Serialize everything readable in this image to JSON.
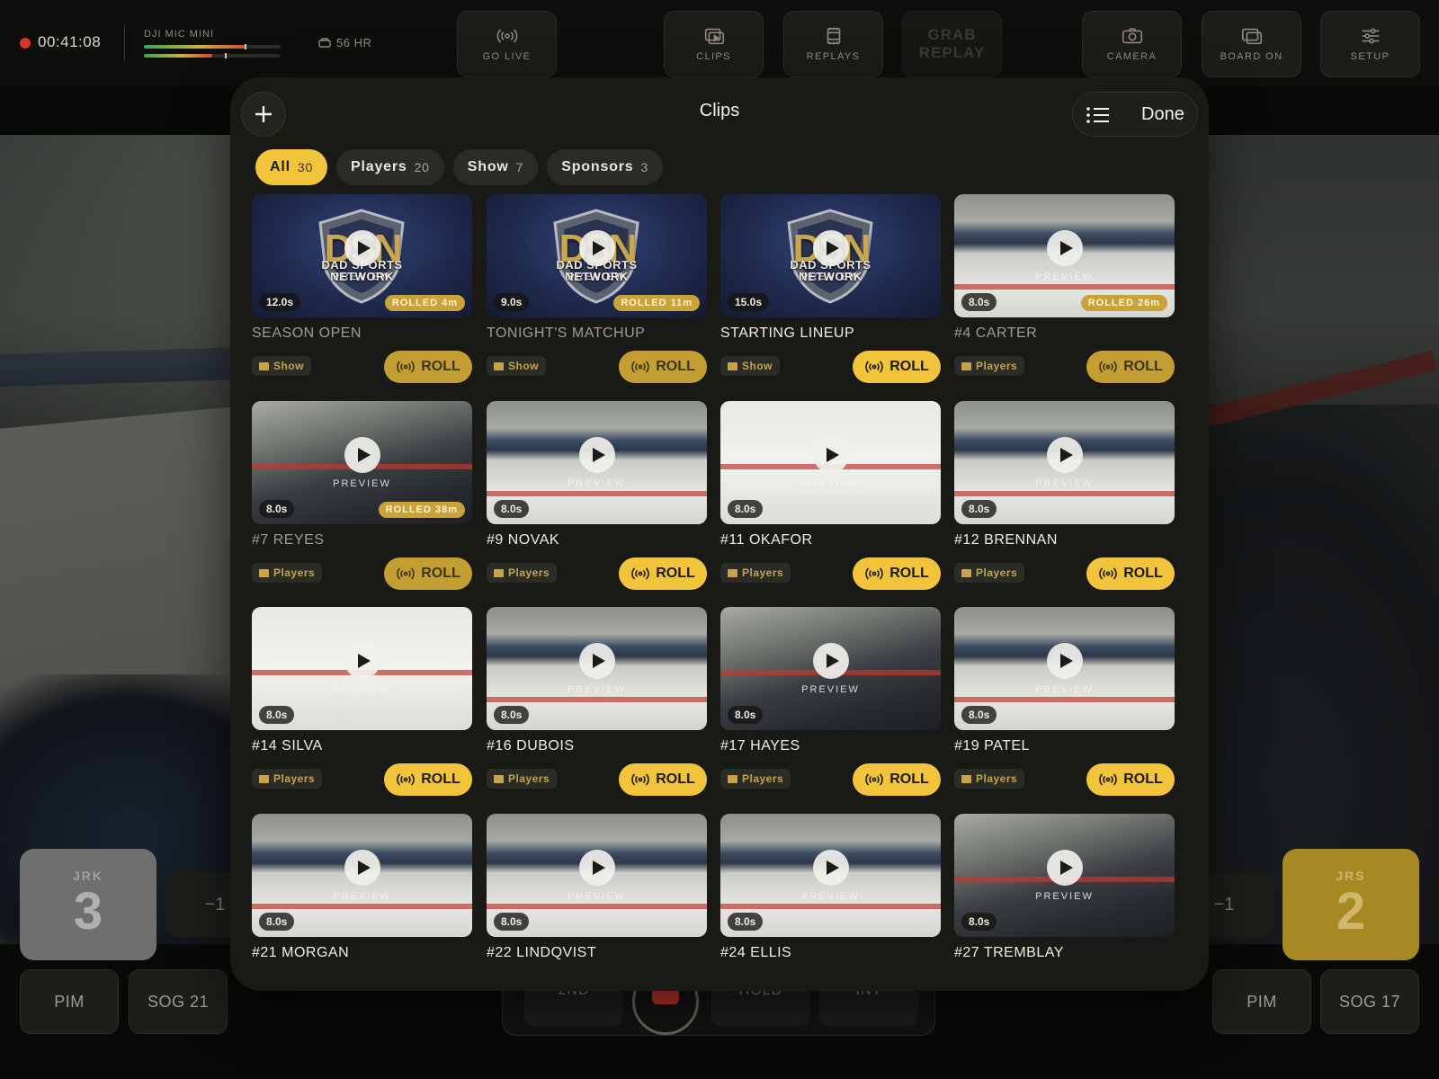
{
  "recorder": {
    "time": "00:41:08",
    "mic_label": "DJI MIC MINI",
    "mic_level_1": 0.75,
    "mic_level_2": 0.5,
    "storage": "56 HR"
  },
  "toolbar": {
    "go_live": "GO LIVE",
    "clips": "CLIPS",
    "replays": "REPLAYS",
    "grab_replay_line1": "GRAB",
    "grab_replay_line2": "REPLAY",
    "camera": "CAMERA",
    "board_on": "BOARD ON",
    "setup": "SETUP"
  },
  "scoreboard": {
    "home": {
      "team": "JRK",
      "score": "3",
      "minus": "−1",
      "pim": "PIM",
      "sog": "SOG 21"
    },
    "away": {
      "team": "JRS",
      "score": "2",
      "minus": "−1",
      "pim": "PIM",
      "sog": "SOG 17"
    },
    "controls": {
      "left": "2ND",
      "right1": "HOLD",
      "right2": "INT"
    }
  },
  "sheet": {
    "title": "Clips",
    "done": "Done",
    "filters": [
      {
        "label": "All",
        "count": "30",
        "active": true
      },
      {
        "label": "Players",
        "count": "20",
        "active": false
      },
      {
        "label": "Show",
        "count": "7",
        "active": false
      },
      {
        "label": "Sponsors",
        "count": "3",
        "active": false
      }
    ],
    "roll_label": "ROLL",
    "preview_label": "PREVIEW",
    "logo_text": "DSN",
    "logo_sub_line1": "DAD SPORTS",
    "logo_sub_line2": "NETWORK",
    "clips": [
      {
        "name": "SEASON OPEN",
        "duration": "12.0s",
        "rolled": "ROLLED 4m",
        "category": "Show",
        "thumb": "logo",
        "dim": true
      },
      {
        "name": "TONIGHT'S MATCHUP",
        "duration": "9.0s",
        "rolled": "ROLLED 11m",
        "category": "Show",
        "thumb": "logo",
        "dim": true
      },
      {
        "name": "STARTING LINEUP",
        "duration": "15.0s",
        "rolled": "",
        "category": "Show",
        "thumb": "logo",
        "dim": false
      },
      {
        "name": "#4 CARTER",
        "duration": "8.0s",
        "rolled": "ROLLED 26m",
        "category": "Players",
        "thumb": "rink",
        "dim": true
      },
      {
        "name": "#7 REYES",
        "duration": "8.0s",
        "rolled": "ROLLED 38m",
        "category": "Players",
        "thumb": "crowd",
        "dim": true
      },
      {
        "name": "#9 NOVAK",
        "duration": "8.0s",
        "rolled": "",
        "category": "Players",
        "thumb": "rink",
        "dim": false
      },
      {
        "name": "#11 OKAFOR",
        "duration": "8.0s",
        "rolled": "",
        "category": "Players",
        "thumb": "ice",
        "dim": false
      },
      {
        "name": "#12 BRENNAN",
        "duration": "8.0s",
        "rolled": "",
        "category": "Players",
        "thumb": "rink",
        "dim": false
      },
      {
        "name": "#14 SILVA",
        "duration": "8.0s",
        "rolled": "",
        "category": "Players",
        "thumb": "ice",
        "dim": false
      },
      {
        "name": "#16 DUBOIS",
        "duration": "8.0s",
        "rolled": "",
        "category": "Players",
        "thumb": "rink",
        "dim": false
      },
      {
        "name": "#17 HAYES",
        "duration": "8.0s",
        "rolled": "",
        "category": "Players",
        "thumb": "crowd",
        "dim": false
      },
      {
        "name": "#19 PATEL",
        "duration": "8.0s",
        "rolled": "",
        "category": "Players",
        "thumb": "rink",
        "dim": false
      },
      {
        "name": "#21 MORGAN",
        "duration": "8.0s",
        "rolled": "",
        "category": "Players",
        "thumb": "rink",
        "dim": false
      },
      {
        "name": "#22 LINDQVIST",
        "duration": "8.0s",
        "rolled": "",
        "category": "Players",
        "thumb": "rink",
        "dim": false
      },
      {
        "name": "#24 ELLIS",
        "duration": "8.0s",
        "rolled": "",
        "category": "Players",
        "thumb": "rink",
        "dim": false
      },
      {
        "name": "#27 TREMBLAY",
        "duration": "8.0s",
        "rolled": "",
        "category": "Players",
        "thumb": "crowd",
        "dim": false
      }
    ]
  }
}
